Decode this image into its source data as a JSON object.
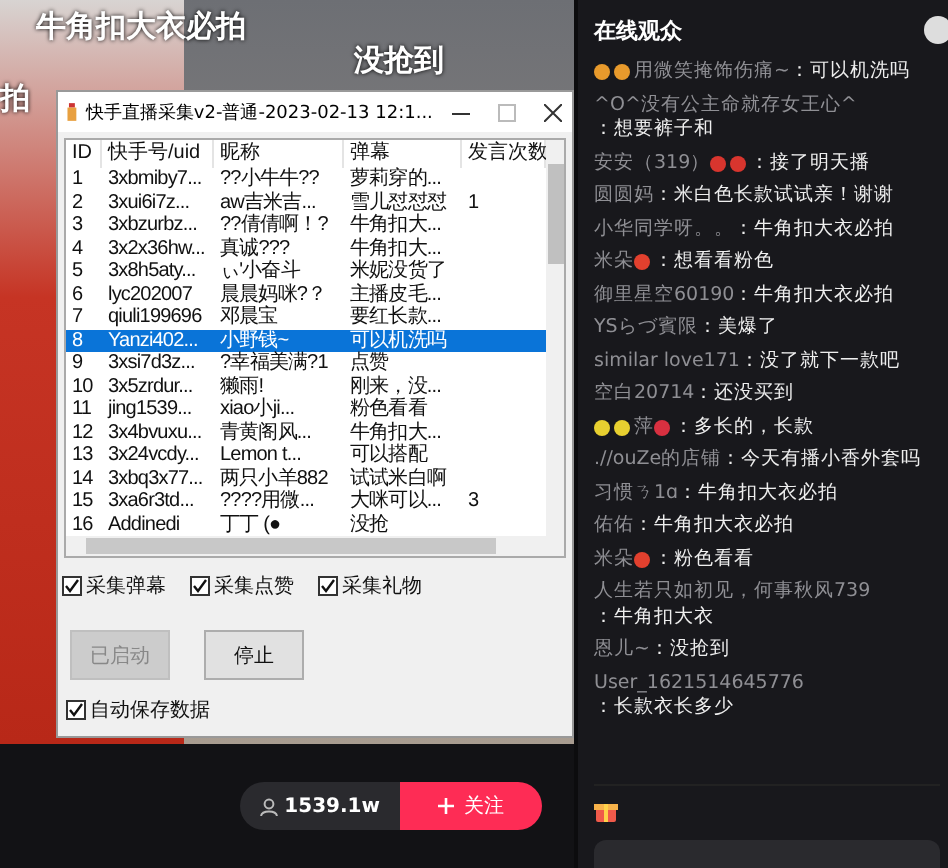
{
  "video": {
    "overlay_comments": [
      {
        "text": "牛角扣大衣必拍"
      },
      {
        "text": "没抢到"
      },
      {
        "text": "拍"
      }
    ]
  },
  "dialog": {
    "title": "快手直播采集v2-普通-2023-02-13 12:1...",
    "table": {
      "columns": [
        "ID",
        "快手号/uid",
        "昵称",
        "弹幕",
        "发言次数"
      ],
      "rows": [
        {
          "cells": [
            "1",
            "3xbmiby7...",
            "??小牛牛??",
            "萝莉穿的..."
          ],
          "selected": false
        },
        {
          "cells": [
            "2",
            "3xui6i7z...",
            "aw吉米吉...",
            "雪儿怼怼怼",
            "1"
          ],
          "selected": false
        },
        {
          "cells": [
            "3",
            "3xbzurbz...",
            "??倩倩啊！?",
            "牛角扣大..."
          ],
          "selected": false
        },
        {
          "cells": [
            "4",
            "3x2x36hw...",
            "真诚???",
            "牛角扣大..."
          ],
          "selected": false
        },
        {
          "cells": [
            "5",
            "3x8h5aty...",
            "ぃ'小奋斗",
            "米妮没货了"
          ],
          "selected": false
        },
        {
          "cells": [
            "6",
            "lyc202007",
            "晨晨妈咪?？",
            "主播皮毛..."
          ],
          "selected": false
        },
        {
          "cells": [
            "7",
            "qiuli199696",
            "邓晨宝",
            "要红长款..."
          ],
          "selected": false
        },
        {
          "cells": [
            "8",
            "Yanzi402...",
            "小野钱~",
            "可以机洗吗"
          ],
          "selected": true
        },
        {
          "cells": [
            "9",
            "3xsi7d3z...",
            "?幸福美满?1",
            "点赞"
          ],
          "selected": false
        },
        {
          "cells": [
            "10",
            "3x5zrdur...",
            "獭雨!",
            "刚来，没..."
          ],
          "selected": false
        },
        {
          "cells": [
            "11",
            "jing1539...",
            "xiao小ji...",
            "粉色看看"
          ],
          "selected": false
        },
        {
          "cells": [
            "12",
            "3x4bvuxu...",
            "青黄阁风...",
            "牛角扣大..."
          ],
          "selected": false
        },
        {
          "cells": [
            "13",
            "3x24vcdy...",
            "Lemon  t...",
            "可以搭配"
          ],
          "selected": false
        },
        {
          "cells": [
            "14",
            "3xbq3x77...",
            "两只小羊882",
            "试试米白啊"
          ],
          "selected": false
        },
        {
          "cells": [
            "15",
            "3xa6r3td...",
            "????用微...",
            "大咪可以...",
            "3"
          ],
          "selected": false
        },
        {
          "cells": [
            "16",
            "Addinedi",
            "丁丁 (●",
            "没抢"
          ],
          "selected": false
        }
      ]
    },
    "options": [
      {
        "label": "采集弹幕",
        "checked": true
      },
      {
        "label": "采集点赞",
        "checked": true
      },
      {
        "label": "采集礼物",
        "checked": true
      }
    ],
    "buttons": [
      {
        "label": "已启动",
        "disabled": true
      },
      {
        "label": "停止",
        "disabled": false
      }
    ],
    "autosave": {
      "label": "自动保存数据",
      "checked": true
    }
  },
  "bottom_bar": {
    "viewers": "1539.1w",
    "follow": "关注"
  },
  "chat": {
    "title": "在线观众",
    "messages": [
      {
        "name": "用微笑掩饰伤痛~",
        "text": "：可以机洗吗",
        "icons_before": [
          {
            "color": "#e89a2c"
          },
          {
            "color": "#e89a2c"
          }
        ]
      },
      {
        "name": "^O^没有公主命就存女王心^",
        "text": "：想要裤子和"
      },
      {
        "name": "安安（319）",
        "text": "：接了明天播",
        "icons_after": [
          {
            "color": "#d8352e"
          },
          {
            "color": "#d8352e"
          }
        ]
      },
      {
        "name": "圆圆妈",
        "text": "：米白色长款试试亲！谢谢"
      },
      {
        "name": "小华同学呀。。",
        "text": "：牛角扣大衣必拍"
      },
      {
        "name": "米朵",
        "text": "：想看看粉色",
        "icons_after": [
          {
            "color": "#e2402e"
          }
        ]
      },
      {
        "name": "御里星空60190",
        "text": "：牛角扣大衣必拍"
      },
      {
        "name": "YSらづ賓限",
        "text": "：美爆了"
      },
      {
        "name": "similar love171",
        "text": "：没了就下一款吧"
      },
      {
        "name": "空白20714",
        "text": "：还没买到"
      },
      {
        "name": "萍",
        "text": "：多长的，长款",
        "icons_before": [
          {
            "color": "#e8d030"
          },
          {
            "color": "#e8d030"
          }
        ],
        "icons_after": [
          {
            "color": "#d83040"
          }
        ]
      },
      {
        "name": ".//ouZe的店铺",
        "text": "：今天有播小香外套吗"
      },
      {
        "name": "习惯ㄋ1ɑ",
        "text": "：牛角扣大衣必拍"
      },
      {
        "name": "佑佑",
        "text": "：牛角扣大衣必拍"
      },
      {
        "name": "米朵",
        "text": "：粉色看看",
        "icons_after": [
          {
            "color": "#e2402e"
          }
        ]
      },
      {
        "name": "人生若只如初见，何事秋风739",
        "text": "：牛角扣大衣"
      },
      {
        "name": "恩儿~",
        "text": "：没抢到"
      },
      {
        "name": "User_1621514645776",
        "text": "：长款衣长多少"
      }
    ]
  }
}
